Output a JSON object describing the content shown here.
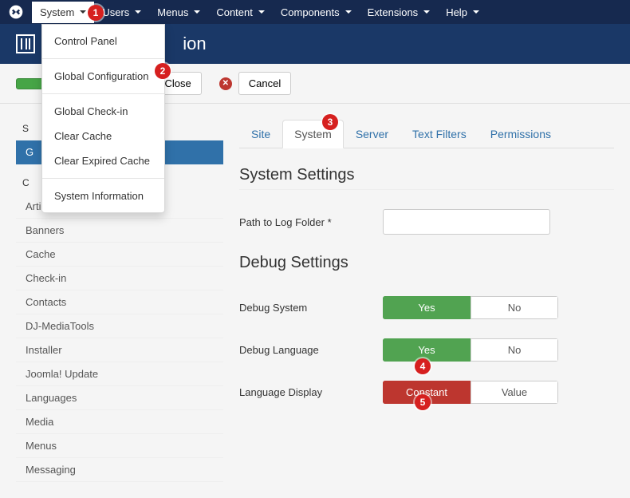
{
  "nav": {
    "items": [
      {
        "label": "System",
        "active": true
      },
      {
        "label": "Users"
      },
      {
        "label": "Menus"
      },
      {
        "label": "Content"
      },
      {
        "label": "Components"
      },
      {
        "label": "Extensions"
      },
      {
        "label": "Help"
      }
    ]
  },
  "dropdown": {
    "groups": [
      [
        "Control Panel"
      ],
      [
        "Global Configuration"
      ],
      [
        "Global Check-in",
        "Clear Cache",
        "Clear Expired Cache"
      ],
      [
        "System Information"
      ]
    ]
  },
  "header": {
    "title_suffix": "ion"
  },
  "toolbar": {
    "save": "",
    "save_close": "Save & Close",
    "cancel": "Cancel"
  },
  "sidebar": {
    "header1": "S",
    "active": "G",
    "header2": "C",
    "items": [
      "Articles",
      "Banners",
      "Cache",
      "Check-in",
      "Contacts",
      "DJ-MediaTools",
      "Installer",
      "Joomla! Update",
      "Languages",
      "Media",
      "Menus",
      "Messaging"
    ]
  },
  "tabs": [
    {
      "label": "Site"
    },
    {
      "label": "System",
      "active": true
    },
    {
      "label": "Server"
    },
    {
      "label": "Text Filters"
    },
    {
      "label": "Permissions"
    }
  ],
  "sections": {
    "system_settings": "System Settings",
    "debug_settings": "Debug Settings"
  },
  "fields": {
    "path_log": {
      "label": "Path to Log Folder *",
      "value": ""
    },
    "debug_system": {
      "label": "Debug System",
      "yes": "Yes",
      "no": "No",
      "value": "Yes"
    },
    "debug_language": {
      "label": "Debug Language",
      "yes": "Yes",
      "no": "No",
      "value": "Yes"
    },
    "language_display": {
      "label": "Language Display",
      "opt1": "Constant",
      "opt2": "Value",
      "value": "Constant"
    }
  },
  "markers": {
    "1": "1",
    "2": "2",
    "3": "3",
    "4": "4",
    "5": "5"
  }
}
